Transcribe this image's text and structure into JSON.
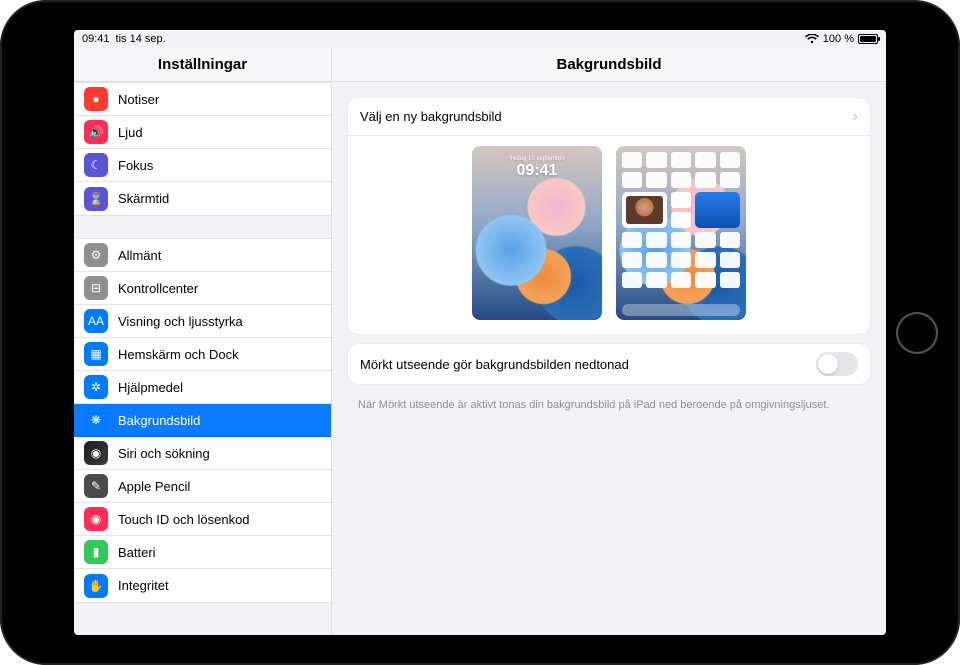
{
  "status": {
    "time": "09:41",
    "date": "tis 14 sep.",
    "battery_text": "100 %"
  },
  "sidebar_title": "Inställningar",
  "groups": [
    {
      "items": [
        {
          "id": "notifications",
          "label": "Notiser",
          "color": "ic-red",
          "glyph": "●"
        },
        {
          "id": "sound",
          "label": "Ljud",
          "color": "ic-pink",
          "glyph": "🔊"
        },
        {
          "id": "focus",
          "label": "Fokus",
          "color": "ic-purple",
          "glyph": "☾"
        },
        {
          "id": "screentime",
          "label": "Skärmtid",
          "color": "ic-purple",
          "glyph": "⌛"
        }
      ]
    },
    {
      "items": [
        {
          "id": "general",
          "label": "Allmänt",
          "color": "ic-gray",
          "glyph": "⚙"
        },
        {
          "id": "controlcenter",
          "label": "Kontrollcenter",
          "color": "ic-gray",
          "glyph": "⊟"
        },
        {
          "id": "display",
          "label": "Visning och ljusstyrka",
          "color": "ic-blue",
          "glyph": "AA"
        },
        {
          "id": "homescreen",
          "label": "Hemskärm och Dock",
          "color": "ic-blue",
          "glyph": "▦"
        },
        {
          "id": "accessibility",
          "label": "Hjälpmedel",
          "color": "ic-blue",
          "glyph": "✲"
        },
        {
          "id": "wallpaper",
          "label": "Bakgrundsbild",
          "color": "ic-blue",
          "glyph": "❋",
          "selected": true
        },
        {
          "id": "siri",
          "label": "Siri och sökning",
          "color": "ic-siri",
          "glyph": "◉"
        },
        {
          "id": "pencil",
          "label": "Apple Pencil",
          "color": "ic-pencil",
          "glyph": "✎"
        },
        {
          "id": "touchid",
          "label": "Touch ID och lösenkod",
          "color": "ic-rose",
          "glyph": "◉"
        },
        {
          "id": "battery",
          "label": "Batteri",
          "color": "ic-green",
          "glyph": "▮"
        },
        {
          "id": "privacy",
          "label": "Integritet",
          "color": "ic-blue",
          "glyph": "✋"
        }
      ]
    }
  ],
  "detail": {
    "title": "Bakgrundsbild",
    "choose_label": "Välj en ny bakgrundsbild",
    "lock_time": "09:41",
    "lock_date": "fredag 10 september",
    "dim_label": "Mörkt utseende gör bakgrundsbilden nedtonad",
    "dim_enabled": false,
    "footer": "När Mörkt utseende är aktivt tonas din bakgrundsbild på iPad ned beroende på omgivningsljuset."
  }
}
